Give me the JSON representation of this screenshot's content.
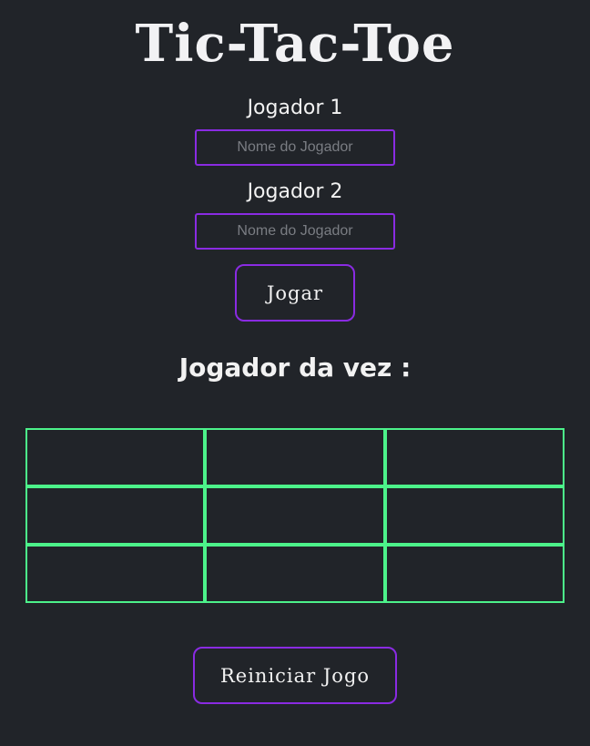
{
  "title": "Tic-Tac-Toe",
  "players": [
    {
      "label": "Jogador 1",
      "placeholder": "Nome do Jogador",
      "value": ""
    },
    {
      "label": "Jogador 2",
      "placeholder": "Nome do Jogador",
      "value": ""
    }
  ],
  "play_button_label": "Jogar",
  "turn_label": "Jogador da vez :",
  "board": {
    "cells": [
      "",
      "",
      "",
      "",
      "",
      "",
      "",
      "",
      ""
    ]
  },
  "restart_button_label": "Reiniciar Jogo",
  "colors": {
    "background": "#212429",
    "accent": "#8a2be2",
    "grid": "#4cf28a",
    "text": "#f2f2f2"
  }
}
